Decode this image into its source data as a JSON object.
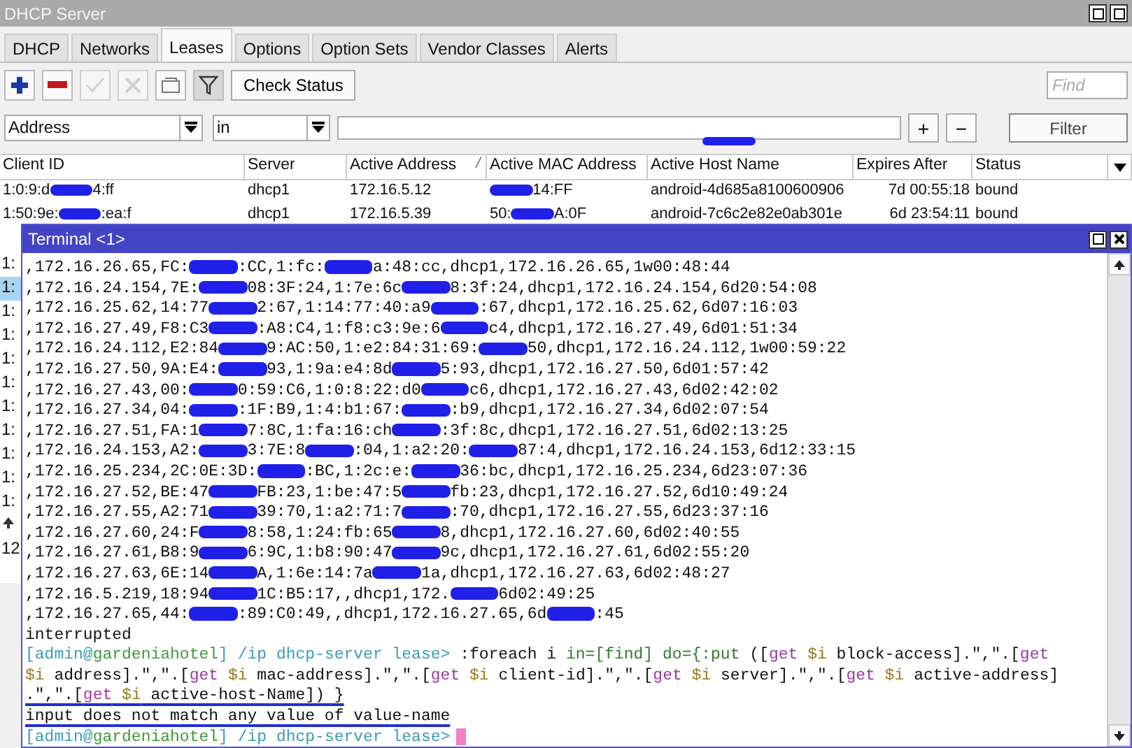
{
  "window": {
    "title": "DHCP Server"
  },
  "tabs": [
    {
      "label": "DHCP",
      "selected": false
    },
    {
      "label": "Networks",
      "selected": false
    },
    {
      "label": "Leases",
      "selected": true
    },
    {
      "label": "Options",
      "selected": false
    },
    {
      "label": "Option Sets",
      "selected": false
    },
    {
      "label": "Vendor Classes",
      "selected": false
    },
    {
      "label": "Alerts",
      "selected": false
    }
  ],
  "toolbar": {
    "buttons": [
      {
        "kind": "add",
        "disabled": false
      },
      {
        "kind": "remove",
        "disabled": false
      },
      {
        "kind": "enable",
        "disabled": true
      },
      {
        "kind": "disable",
        "disabled": true
      },
      {
        "kind": "comment",
        "disabled": false
      },
      {
        "kind": "filter",
        "disabled": false
      }
    ],
    "check_status": "Check Status",
    "find": {
      "placeholder": "Find"
    }
  },
  "filter": {
    "field": "Address",
    "operator": "in",
    "add": "+",
    "remove": "−",
    "button": "Filter"
  },
  "table": {
    "columns": [
      {
        "label": "Client ID",
        "sorted": false
      },
      {
        "label": "Server",
        "sorted": false
      },
      {
        "label": "Active Address",
        "sorted": true
      },
      {
        "label": "Active MAC Address",
        "sorted": false
      },
      {
        "label": "Active Host Name",
        "sorted": false
      },
      {
        "label": "Expires After",
        "sorted": false
      },
      {
        "label": "Status",
        "sorted": false
      }
    ],
    "rows": [
      [
        [
          "1:0:9:d",
          {
            "kind": "redacted"
          },
          "4:ff"
        ],
        [
          "dhcp1"
        ],
        [
          "172.16.5.12"
        ],
        [
          {
            "kind": "redacted"
          },
          "14:FF"
        ],
        [
          "android-4d685a8100600906"
        ],
        [
          "7d 00:55:18"
        ],
        [
          "bound"
        ]
      ],
      [
        [
          "1:50:9e:",
          {
            "kind": "redacted"
          },
          ":ea:f"
        ],
        [
          "dhcp1"
        ],
        [
          "172.16.5.39"
        ],
        [
          "50:",
          {
            "kind": "redacted"
          },
          "A:0F"
        ],
        [
          "android-7c6c2e82e0ab301e"
        ],
        [
          "6d 23:54:11"
        ],
        [
          "bound"
        ]
      ]
    ],
    "row_stubs": [
      {
        "kind": "text",
        "text": "1:",
        "selected": false
      },
      {
        "kind": "text",
        "text": "1:",
        "selected": true
      },
      {
        "kind": "text",
        "text": "1:",
        "selected": false
      },
      {
        "kind": "text",
        "text": "1:",
        "selected": false
      },
      {
        "kind": "text",
        "text": "1:",
        "selected": false
      },
      {
        "kind": "text",
        "text": "1:",
        "selected": false
      },
      {
        "kind": "text",
        "text": "1:",
        "selected": false
      },
      {
        "kind": "text",
        "text": "1:",
        "selected": false
      },
      {
        "kind": "text",
        "text": "1:",
        "selected": false
      },
      {
        "kind": "text",
        "text": "1:",
        "selected": false
      },
      {
        "kind": "text",
        "text": "1:",
        "selected": false
      },
      {
        "kind": "arrow",
        "selected": false
      },
      {
        "kind": "text",
        "text": "12",
        "selected": false
      }
    ]
  },
  "terminal": {
    "title": "Terminal <1>",
    "output_lines": [
      [
        ",172.16.26.65,FC:",
        {
          "kind": "redacted"
        },
        ":CC,1:fc:",
        {
          "kind": "redacted"
        },
        "a:48:cc,dhcp1,172.16.26.65,1w00:48:44"
      ],
      [
        ",172.16.24.154,7E:",
        {
          "kind": "redacted"
        },
        "08:3F:24,1:7e:6c",
        {
          "kind": "redacted"
        },
        "8:3f:24,dhcp1,172.16.24.154,6d20:54:08"
      ],
      [
        ",172.16.25.62,14:77",
        {
          "kind": "redacted"
        },
        "2:67,1:14:77:40:a9",
        {
          "kind": "redacted"
        },
        ":67,dhcp1,172.16.25.62,6d07:16:03"
      ],
      [
        ",172.16.27.49,F8:C3",
        {
          "kind": "redacted"
        },
        ":A8:C4,1:f8:c3:9e:6",
        {
          "kind": "redacted"
        },
        "c4,dhcp1,172.16.27.49,6d01:51:34"
      ],
      [
        ",172.16.24.112,E2:84",
        {
          "kind": "redacted"
        },
        "9:AC:50,1:e2:84:31:69:",
        {
          "kind": "redacted"
        },
        "50,dhcp1,172.16.24.112,1w00:59:22"
      ],
      [
        ",172.16.27.50,9A:E4:",
        {
          "kind": "redacted"
        },
        "93,1:9a:e4:8d",
        {
          "kind": "redacted"
        },
        "5:93,dhcp1,172.16.27.50,6d01:57:42"
      ],
      [
        ",172.16.27.43,00:",
        {
          "kind": "redacted"
        },
        "0:59:C6,1:0:8:22:d0",
        {
          "kind": "redacted"
        },
        "c6,dhcp1,172.16.27.43,6d02:42:02"
      ],
      [
        ",172.16.27.34,04:",
        {
          "kind": "redacted"
        },
        ":1F:B9,1:4:b1:67:",
        {
          "kind": "redacted"
        },
        ":b9,dhcp1,172.16.27.34,6d02:07:54"
      ],
      [
        ",172.16.27.51,FA:1",
        {
          "kind": "redacted"
        },
        "7:8C,1:fa:16:ch",
        {
          "kind": "redacted"
        },
        ":3f:8c,dhcp1,172.16.27.51,6d02:13:25"
      ],
      [
        ",172.16.24.153,A2:",
        {
          "kind": "redacted"
        },
        "3:7E:8",
        {
          "kind": "redacted"
        },
        ":04,1:a2:20:",
        {
          "kind": "redacted"
        },
        "87:4,dhcp1,172.16.24.153,6d12:33:15"
      ],
      [
        ",172.16.25.234,2C:0E:3D:",
        {
          "kind": "redacted"
        },
        ":BC,1:2c:e:",
        {
          "kind": "redacted"
        },
        "36:bc,dhcp1,172.16.25.234,6d23:07:36"
      ],
      [
        ",172.16.27.52,BE:47",
        {
          "kind": "redacted"
        },
        "FB:23,1:be:47:5",
        {
          "kind": "redacted"
        },
        "fb:23,dhcp1,172.16.27.52,6d10:49:24"
      ],
      [
        ",172.16.27.55,A2:71",
        {
          "kind": "redacted"
        },
        "39:70,1:a2:71:7",
        {
          "kind": "redacted"
        },
        ":70,dhcp1,172.16.27.55,6d23:37:16"
      ],
      [
        ",172.16.27.60,24:F",
        {
          "kind": "redacted"
        },
        "8:58,1:24:fb:65",
        {
          "kind": "redacted"
        },
        "8,dhcp1,172.16.27.60,6d02:40:55"
      ],
      [
        ",172.16.27.61,B8:9",
        {
          "kind": "redacted"
        },
        "6:9C,1:b8:90:47",
        {
          "kind": "redacted"
        },
        "9c,dhcp1,172.16.27.61,6d02:55:20"
      ],
      [
        ",172.16.27.63,6E:14",
        {
          "kind": "redacted"
        },
        "A,1:6e:14:7a",
        {
          "kind": "redacted"
        },
        "1a,dhcp1,172.16.27.63,6d02:48:27"
      ],
      [
        ",172.16.5.219,18:94",
        {
          "kind": "redacted"
        },
        "1C:B5:17,,dhcp1,172.",
        {
          "kind": "redacted"
        },
        "6d02:49:25"
      ],
      [
        ",172.16.27.65,44:",
        {
          "kind": "redacted"
        },
        ":89:C0:49,,dhcp1,172.16.27.65,6d",
        {
          "kind": "redacted"
        },
        ":45"
      ]
    ],
    "session": [
      {
        "segments": [
          {
            "kind": "cmd",
            "text": "interrupted"
          }
        ],
        "underlined": false,
        "cursor": false
      },
      {
        "segments": [
          {
            "kind": "prompt",
            "text": "[admin@"
          },
          {
            "kind": "host",
            "text": "gardeniahotel"
          },
          {
            "kind": "prompt",
            "text": "] /ip dhcp-server lease>"
          },
          {
            "kind": "cmd",
            "text": " :foreach i "
          },
          {
            "kind": "arg",
            "text": "in=[find] do={:put"
          },
          {
            "kind": "cmd",
            "text": " (["
          },
          {
            "kind": "keyword",
            "text": "get"
          },
          {
            "kind": "var",
            "text": " $i"
          },
          {
            "kind": "cmd",
            "text": " block-access].\",\".["
          },
          {
            "kind": "keyword",
            "text": "get"
          }
        ],
        "underlined": false,
        "cursor": false
      },
      {
        "segments": [
          {
            "kind": "var",
            "text": "$i"
          },
          {
            "kind": "cmd",
            "text": " address].\",\".["
          },
          {
            "kind": "keyword",
            "text": "get"
          },
          {
            "kind": "var",
            "text": " $i"
          },
          {
            "kind": "cmd",
            "text": " mac-address].\",\".["
          },
          {
            "kind": "keyword",
            "text": "get"
          },
          {
            "kind": "var",
            "text": " $i"
          },
          {
            "kind": "cmd",
            "text": " client-id].\",\".["
          },
          {
            "kind": "keyword",
            "text": "get"
          },
          {
            "kind": "var",
            "text": " $i"
          },
          {
            "kind": "cmd",
            "text": " server].\",\".["
          },
          {
            "kind": "keyword",
            "text": "get"
          },
          {
            "kind": "var",
            "text": " $i"
          },
          {
            "kind": "cmd",
            "text": " active-address]"
          }
        ],
        "underlined": false,
        "cursor": false
      },
      {
        "segments": [
          {
            "kind": "cmd",
            "text": ".\",\".["
          },
          {
            "kind": "keyword",
            "text": "get"
          },
          {
            "kind": "var",
            "text": " $i"
          },
          {
            "kind": "cmd",
            "text": " active-host-Name]) }"
          }
        ],
        "underlined": true,
        "cursor": false
      },
      {
        "segments": [
          {
            "kind": "cmd",
            "text": "input does not match any value of value-name"
          }
        ],
        "underlined": true,
        "cursor": false
      },
      {
        "segments": [
          {
            "kind": "prompt",
            "text": "[admin@"
          },
          {
            "kind": "host",
            "text": "gardeniahotel"
          },
          {
            "kind": "prompt",
            "text": "] /ip dhcp-server lease>"
          }
        ],
        "underlined": false,
        "cursor": true
      }
    ]
  }
}
